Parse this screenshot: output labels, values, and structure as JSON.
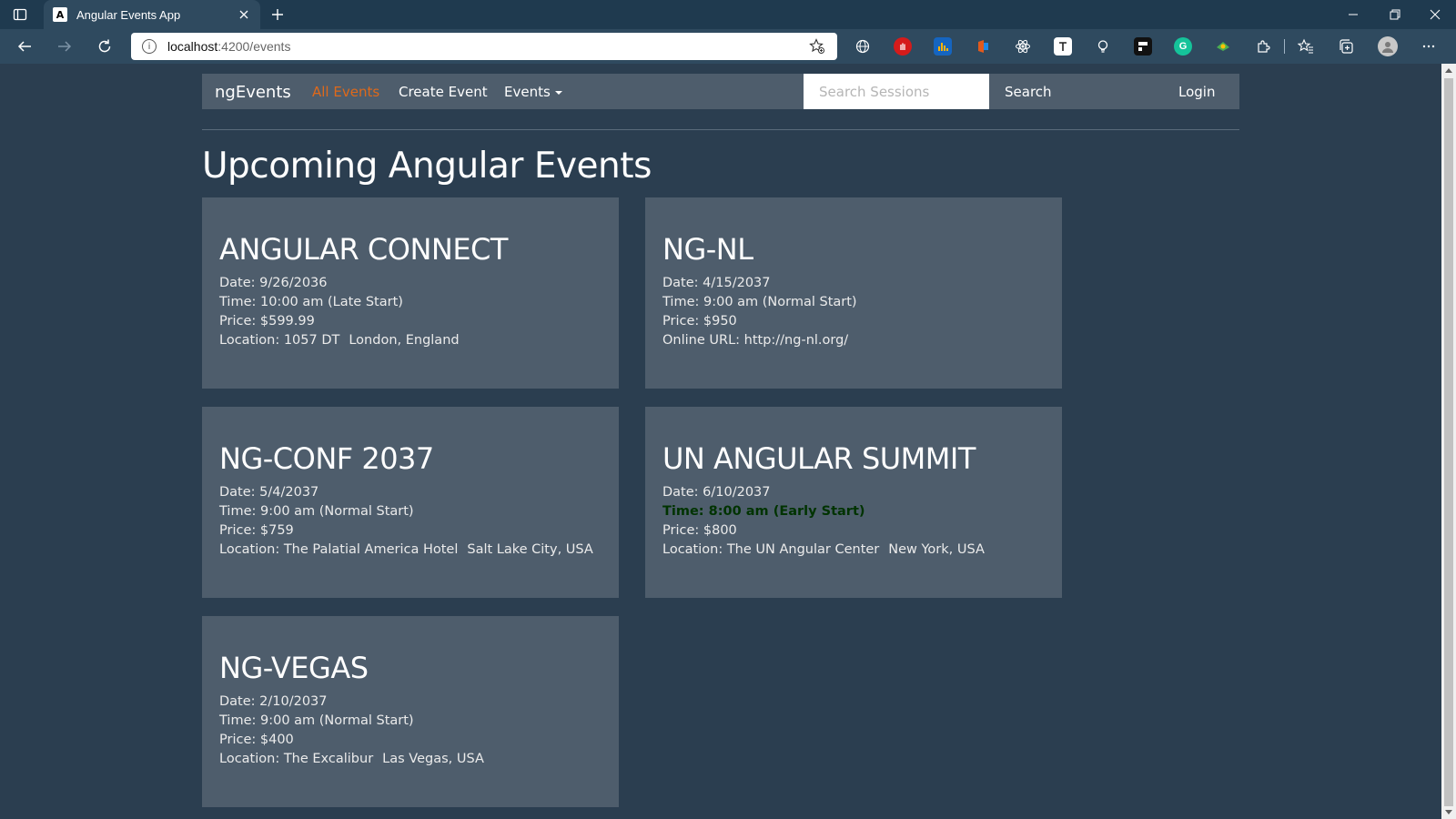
{
  "browser": {
    "tab_title": "Angular Events App",
    "tab_favicon": "A",
    "url_host": "localhost",
    "url_path": ":4200/events"
  },
  "navbar": {
    "brand": "ngEvents",
    "links": [
      "All Events",
      "Create Event",
      "Events"
    ],
    "search_placeholder": "Search Sessions",
    "search_button": "Search",
    "login": "Login"
  },
  "heading": "Upcoming Angular Events",
  "events": [
    {
      "name": "ANGULAR CONNECT",
      "date": "Date: 9/26/2036",
      "time": "Time: 10:00 am (Late Start)",
      "price": "Price: $599.99",
      "location_label": "Location: 1057 DT",
      "location_city": "London, England"
    },
    {
      "name": "NG-NL",
      "date": "Date: 4/15/2037",
      "time": "Time: 9:00 am (Normal Start)",
      "price": "Price: $950",
      "location_label": "Online URL: http://ng-nl.org/",
      "location_city": ""
    },
    {
      "name": "NG-CONF 2037",
      "date": "Date: 5/4/2037",
      "time": "Time: 9:00 am (Normal Start)",
      "price": "Price: $759",
      "location_label": "Location: The Palatial America Hotel",
      "location_city": "Salt Lake City, USA"
    },
    {
      "name": "UN ANGULAR SUMMIT",
      "date": "Date: 6/10/2037",
      "time": "Time: 8:00 am (Early Start)",
      "price": "Price: $800",
      "location_label": "Location: The UN Angular Center",
      "location_city": "New York, USA"
    },
    {
      "name": "NG-VEGAS",
      "date": "Date: 2/10/2037",
      "time": "Time: 9:00 am (Normal Start)",
      "price": "Price: $400",
      "location_label": "Location: The Excalibur",
      "location_city": "Las Vegas, USA"
    }
  ],
  "colors": {
    "background": "#2b3e50",
    "navbar": "#4e5d6c",
    "card": "#4e5d6c",
    "active_link": "#df691a",
    "early_start": "#003300"
  }
}
